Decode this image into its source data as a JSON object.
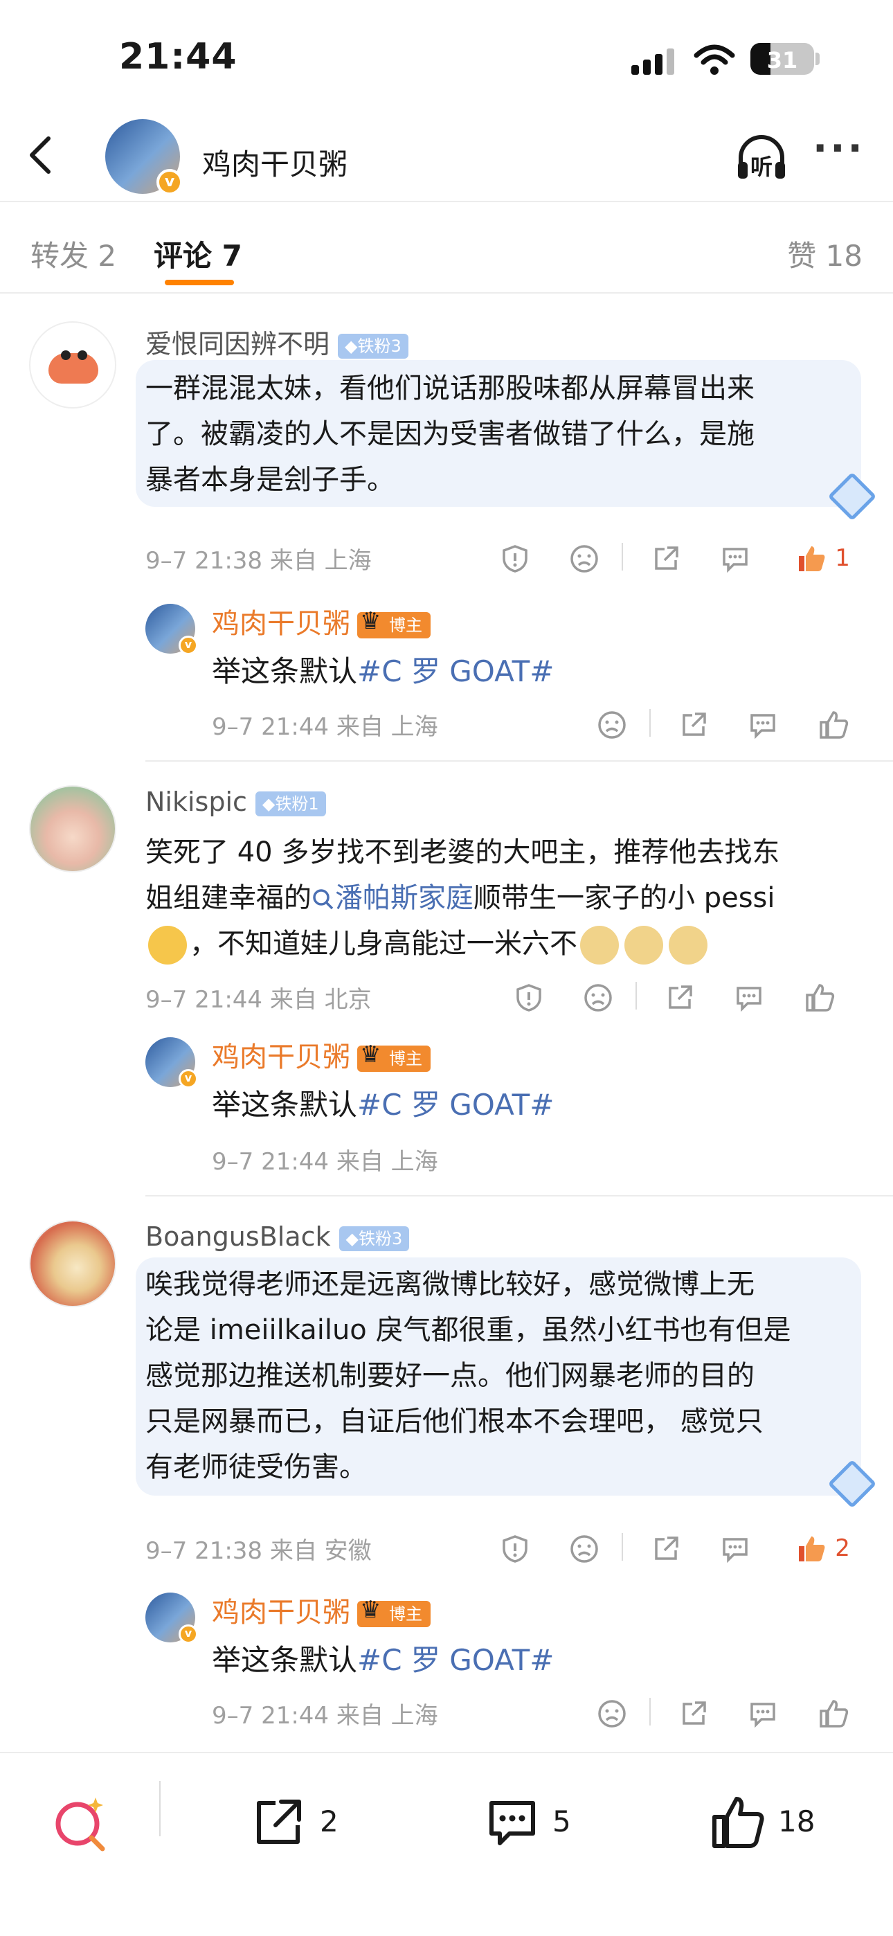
{
  "status_bar": {
    "time": "21:44",
    "battery": "31"
  },
  "nav": {
    "title": "鸡肉干贝粥",
    "listen_label": "听"
  },
  "tabs": {
    "repost": "转发 2",
    "comment": "评论 7",
    "like": "赞 18"
  },
  "comments": [
    {
      "username": "爱恨同因辨不明",
      "fan_badge": "铁粉3",
      "lines": [
        "一群混混太妹，看他们说话那股味都从屏幕冒出来",
        "了。被霸凌的人不是因为受害者做错了什么，是施",
        "暴者本身是刽子手。"
      ],
      "meta": "9–7 21:38  来自 上海",
      "likes": "1"
    },
    {
      "username": "Nikispic",
      "fan_badge": "铁粉1",
      "line1": "笑死了 40 多岁找不到老婆的大吧主，推荐他去找东",
      "line2_pre": "姐组建幸福的",
      "line2_link": "潘帕斯家庭",
      "line2_post": "顺带生一家子的小 pessi",
      "line3": "，不知道娃儿身高能过一米六不",
      "meta": "9–7 21:44  来自 北京"
    },
    {
      "username": "BoangusBlack",
      "fan_badge": "铁粉3",
      "lines": [
        "唉我觉得老师还是远离微博比较好，感觉微博上无",
        "论是 imeiilkailuo 戾气都很重，虽然小红书也有但是",
        "感觉那边推送机制要好一点。他们网暴老师的目的",
        "只是网暴而已，自证后他们根本不会理吧， 感觉只",
        "有老师徒受伤害。"
      ],
      "meta": "9–7 21:38  来自 安徽",
      "likes": "2"
    }
  ],
  "reply": {
    "name": "鸡肉干贝粥",
    "badge": "博主",
    "text_pre": "举这条默认",
    "topic": "#C 罗 GOAT#",
    "meta": "9–7 21:44  来自 上海"
  },
  "bottom_bar": {
    "reposts": "2",
    "comments": "5",
    "likes": "18"
  },
  "colors": {
    "accent": "#ff8200",
    "link": "#4a6fb3",
    "like_active": "#e0502d",
    "bubble": "#eef3fb"
  }
}
